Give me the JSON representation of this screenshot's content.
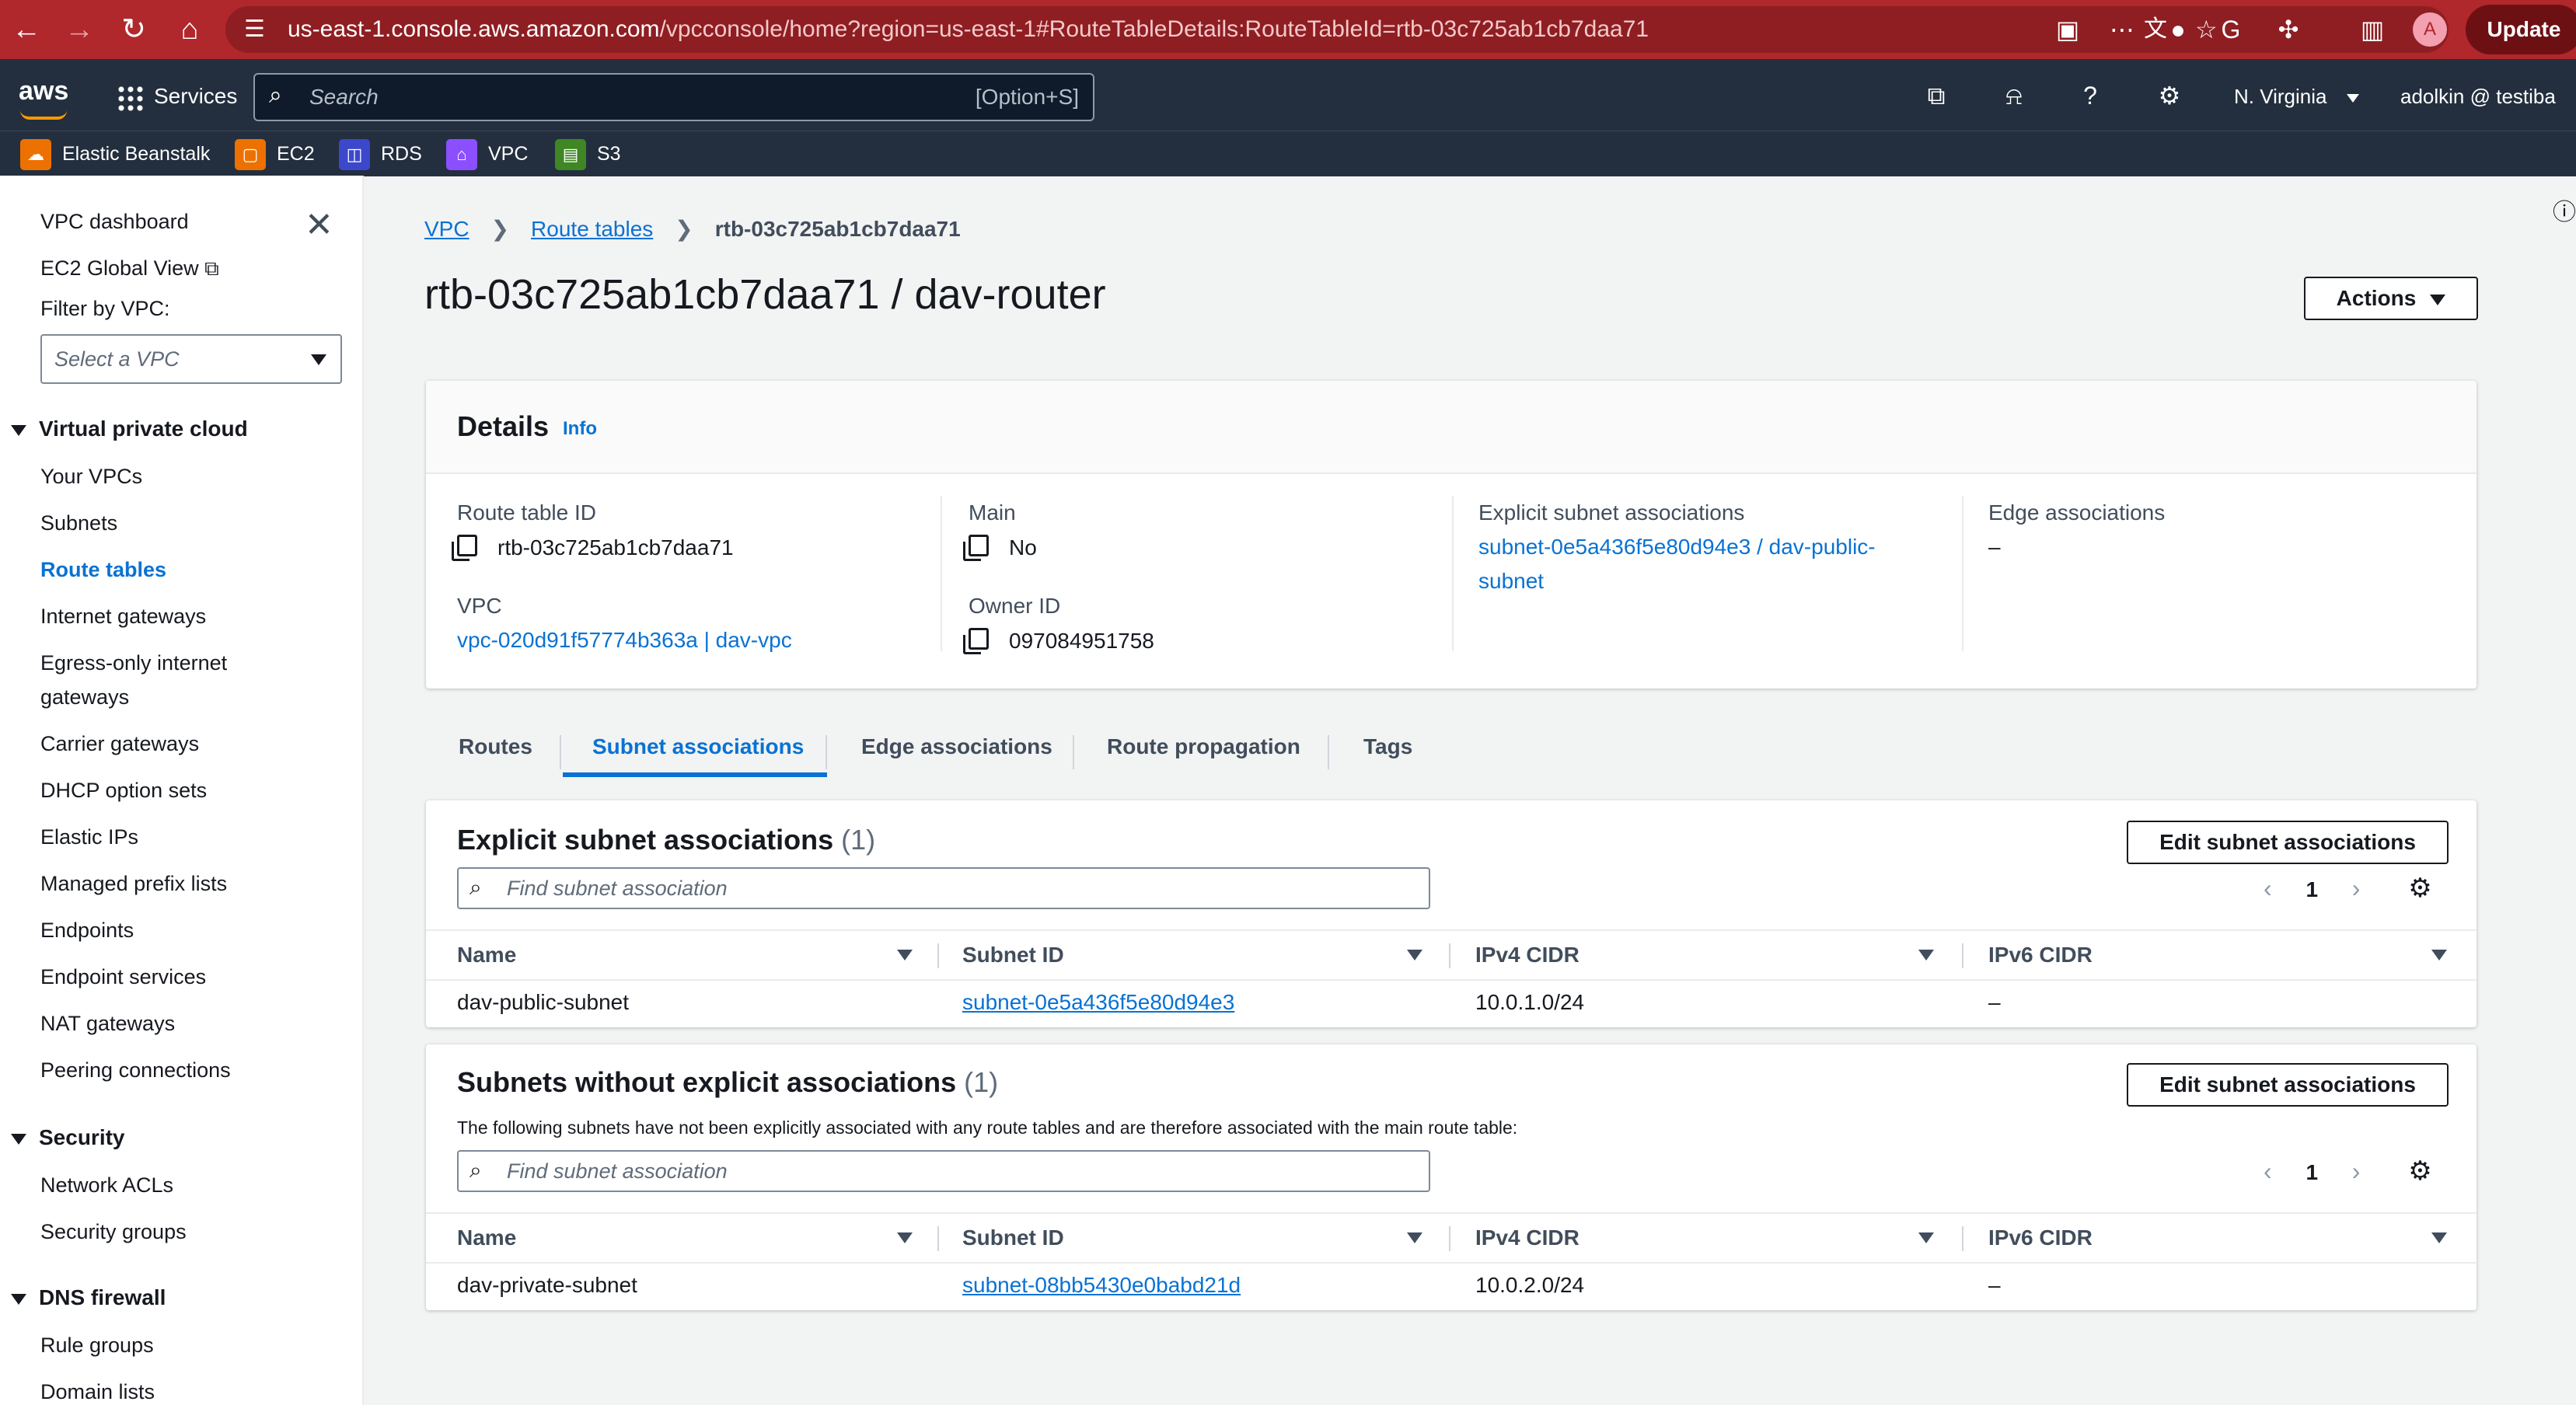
{
  "browser": {
    "url_host": "us-east-1.console.aws.amazon.com",
    "url_path": "/vpcconsole/home?region=us-east-1#RouteTableDetails:RouteTableId=rtb-03c725ab1cb7daa71",
    "update_label": "Update",
    "profile_initial": "A"
  },
  "topnav": {
    "logo": "aws",
    "services_label": "Services",
    "search_placeholder": "Search",
    "search_shortcut": "[Option+S]",
    "region": "N. Virginia",
    "user": "adolkin @ testiba"
  },
  "favorites": [
    {
      "label": "Elastic Beanstalk",
      "color": "#ed7100"
    },
    {
      "label": "EC2",
      "color": "#ed7100"
    },
    {
      "label": "RDS",
      "color": "#3b48cc"
    },
    {
      "label": "VPC",
      "color": "#8c4fff"
    },
    {
      "label": "S3",
      "color": "#3f8624"
    }
  ],
  "sidebar": {
    "dashboard": "VPC dashboard",
    "ec2_global": "EC2 Global View",
    "filter_label": "Filter by VPC:",
    "filter_placeholder": "Select a VPC",
    "sections": {
      "vpc": "Virtual private cloud",
      "security": "Security",
      "dns": "DNS firewall"
    },
    "vpc_items": [
      "Your VPCs",
      "Subnets",
      "Route tables",
      "Internet gateways",
      "Egress-only internet",
      "gateways",
      "Carrier gateways",
      "DHCP option sets",
      "Elastic IPs",
      "Managed prefix lists",
      "Endpoints",
      "Endpoint services",
      "NAT gateways",
      "Peering connections"
    ],
    "security_items": [
      "Network ACLs",
      "Security groups"
    ],
    "dns_items": [
      "Rule groups",
      "Domain lists"
    ]
  },
  "breadcrumb": {
    "vpc": "VPC",
    "route_tables": "Route tables",
    "current": "rtb-03c725ab1cb7daa71"
  },
  "page_title": "rtb-03c725ab1cb7daa71 / dav-router",
  "actions_label": "Actions",
  "details": {
    "title": "Details",
    "info": "Info",
    "route_table_id_label": "Route table ID",
    "route_table_id": "rtb-03c725ab1cb7daa71",
    "vpc_label": "VPC",
    "vpc_value": "vpc-020d91f57774b363a | dav-vpc",
    "main_label": "Main",
    "main_value": "No",
    "owner_label": "Owner ID",
    "owner_value": "097084951758",
    "explicit_label": "Explicit subnet associations",
    "explicit_value_1": "subnet-0e5a436f5e80d94e3 / dav-public-",
    "explicit_value_2": "subnet",
    "edge_label": "Edge associations",
    "edge_value": "–"
  },
  "tabs": [
    "Routes",
    "Subnet associations",
    "Edge associations",
    "Route propagation",
    "Tags"
  ],
  "explicit_table": {
    "title": "Explicit subnet associations",
    "count": "(1)",
    "edit_label": "Edit subnet associations",
    "search_placeholder": "Find subnet association",
    "page": "1",
    "columns": [
      "Name",
      "Subnet ID",
      "IPv4 CIDR",
      "IPv6 CIDR"
    ],
    "rows": [
      [
        "dav-public-subnet",
        "subnet-0e5a436f5e80d94e3",
        "10.0.1.0/24",
        "–"
      ]
    ]
  },
  "implicit_table": {
    "title": "Subnets without explicit associations",
    "count": "(1)",
    "edit_label": "Edit subnet associations",
    "description": "The following subnets have not been explicitly associated with any route tables and are therefore associated with the main route table:",
    "search_placeholder": "Find subnet association",
    "page": "1",
    "columns": [
      "Name",
      "Subnet ID",
      "IPv4 CIDR",
      "IPv6 CIDR"
    ],
    "rows": [
      [
        "dav-private-subnet",
        "subnet-08bb5430e0babd21d",
        "10.0.2.0/24",
        "–"
      ]
    ]
  }
}
